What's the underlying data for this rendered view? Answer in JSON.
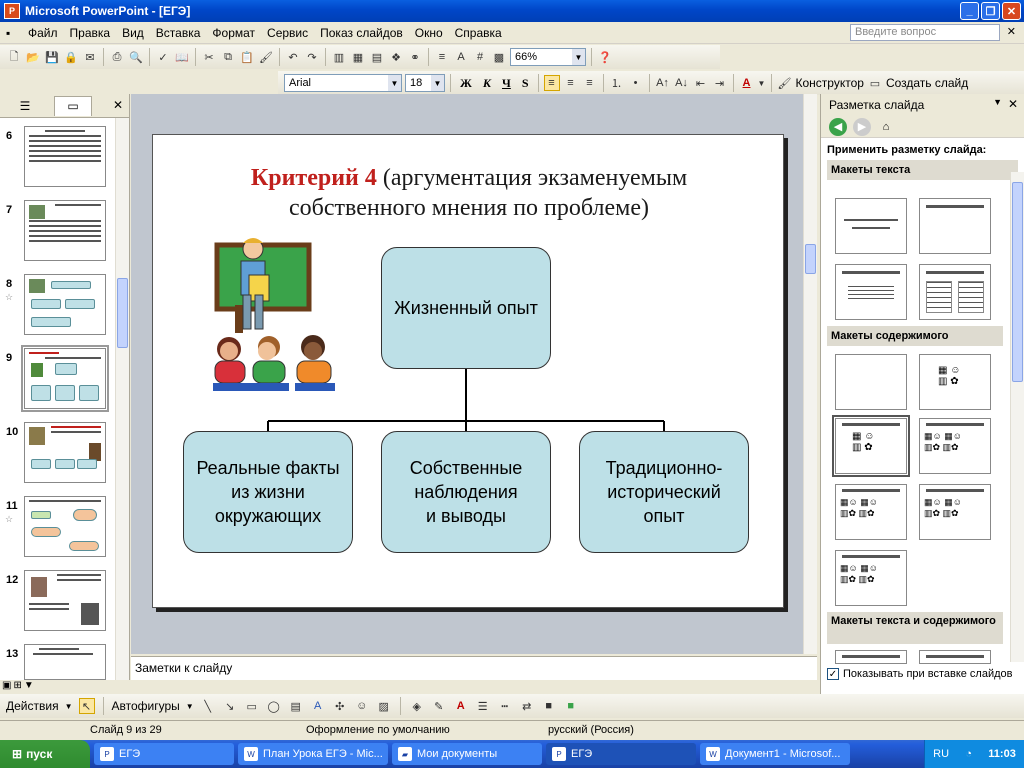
{
  "window": {
    "title": "Microsoft PowerPoint - [ЕГЭ]"
  },
  "menu": {
    "items": [
      "Файл",
      "Правка",
      "Вид",
      "Вставка",
      "Формат",
      "Сервис",
      "Показ слайдов",
      "Окно",
      "Справка"
    ],
    "ask_placeholder": "Введите вопрос"
  },
  "standard_toolbar": {
    "zoom": "66%"
  },
  "format_toolbar": {
    "font": "Arial",
    "size": "18",
    "bold": "Ж",
    "italic": "К",
    "underline": "Ч",
    "shadow": "S",
    "designer": "Конструктор",
    "new_slide": "Создать слайд"
  },
  "slides_panel": {
    "slides": [
      {
        "number": "6"
      },
      {
        "number": "7"
      },
      {
        "number": "8"
      },
      {
        "number": "9",
        "selected": true
      },
      {
        "number": "10"
      },
      {
        "number": "11"
      },
      {
        "number": "12"
      },
      {
        "number": "13"
      }
    ]
  },
  "current_slide": {
    "title_bold": "Критерий 4",
    "title_rest": " (аргументация экзаменуемым собственного мнения по проблеме)",
    "top_box": "Жизненный опыт",
    "boxes": [
      "Реальные факты\nиз жизни\nокружающих",
      "Собственные\nнаблюдения\nи выводы",
      "Традиционно-\nисторический\nопыт"
    ]
  },
  "notes": {
    "placeholder": "Заметки к слайду"
  },
  "task_pane": {
    "title": "Разметка слайда",
    "apply_label": "Применить разметку слайда:",
    "sections": [
      "Макеты текста",
      "Макеты содержимого",
      "Макеты текста и содержимого"
    ],
    "show_on_insert": "Показывать при вставке слайдов"
  },
  "drawing_toolbar": {
    "actions": "Действия",
    "autoshapes": "Автофигуры"
  },
  "status": {
    "slide": "Слайд 9 из 29",
    "design": "Оформление по умолчанию",
    "language": "русский (Россия)"
  },
  "taskbar": {
    "start": "пуск",
    "tasks": [
      "ЕГЭ",
      "План Урока ЕГЭ - Mic...",
      "Мои документы",
      "ЕГЭ",
      "Документ1 - Microsof..."
    ],
    "active_index": 3,
    "lang": "RU",
    "time": "11:03"
  },
  "colors": {
    "title_red": "#c0201c",
    "box_fill": "#bde0e7",
    "titlebar": "#0046c8"
  }
}
